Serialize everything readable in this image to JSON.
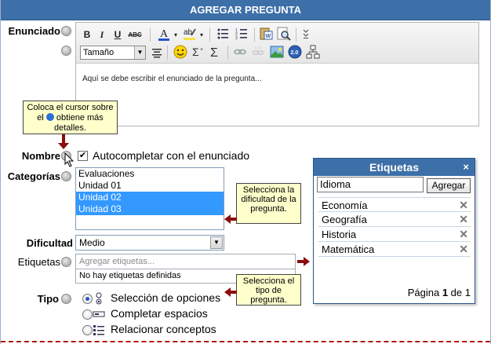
{
  "header": {
    "title": "AGREGAR PREGUNTA"
  },
  "labels": {
    "enunciado": "Enunciado",
    "nombre": "Nombre",
    "categorias": "Categorías",
    "dificultad": "Dificultad",
    "etiquetas": "Etiquetas",
    "tipo": "Tipo"
  },
  "editor": {
    "toolbar": {
      "bold": "B",
      "italic": "I",
      "underline": "U",
      "strike": "ABC",
      "size_select": "Tamaño"
    },
    "placeholder": "Aquí se debe escribir el enunciado de la pregunta..."
  },
  "tooltip": {
    "text_before": "Coloca el cursor sobre el",
    "text_after": "obtiene más detalles."
  },
  "nombre": {
    "autocomplete_label": "Autocompletar con el enunciado",
    "checked": true
  },
  "categorias": {
    "items": [
      {
        "label": "Evaluaciones",
        "selected": false
      },
      {
        "label": "Unidad 01",
        "selected": false
      },
      {
        "label": "Unidad 02",
        "selected": true
      },
      {
        "label": "Unidad 03",
        "selected": true
      }
    ]
  },
  "tip_dificultad": {
    "text": "Selecciona la dificultad de la pregunta."
  },
  "dificultad": {
    "value": "Medio"
  },
  "etiquetas_field": {
    "placeholder": "Agregar etiquetas...",
    "empty_text": "No hay etiquetas definidas"
  },
  "tip_tipo": {
    "text": "Selecciona el tipo de pregunta."
  },
  "tipo": {
    "options": [
      {
        "label": "Selección de opciones",
        "selected": true
      },
      {
        "label": "Completar espacios",
        "selected": false
      },
      {
        "label": "Relacionar conceptos",
        "selected": false
      }
    ]
  },
  "panel": {
    "title": "Etiquetas",
    "close": "×",
    "input_value": "Idioma",
    "add_button": "Agregar",
    "items": [
      "Economía",
      "Geografía",
      "Historia",
      "Matemática"
    ],
    "remove_glyph": "✕",
    "pagination": {
      "prefix": "Página",
      "current": "1",
      "middle": "de",
      "total": "1"
    }
  },
  "colors": {
    "header_bg": "#3d6fa8",
    "tooltip_bg": "#ffffcc",
    "selection": "#3399ff",
    "arrow": "#8b0d0d",
    "dash": "#b21414"
  }
}
